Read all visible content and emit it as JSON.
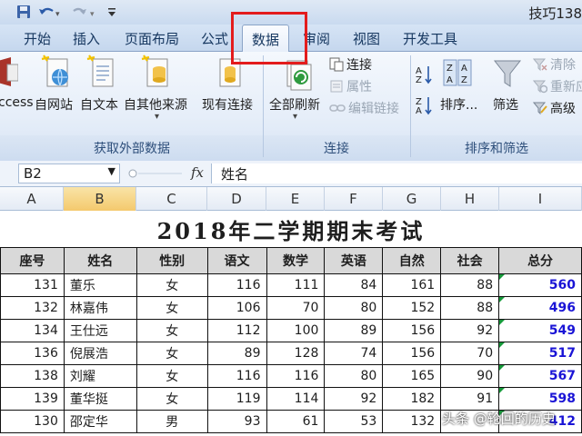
{
  "window": {
    "title": "技巧138"
  },
  "tabs": [
    "开始",
    "插入",
    "页面布局",
    "公式",
    "数据",
    "审阅",
    "视图",
    "开发工具"
  ],
  "ribbon": {
    "external_data": {
      "label": "获取外部数据",
      "buttons": [
        "ccess",
        "自网站",
        "自文本",
        "自其他来源",
        "现有连接"
      ]
    },
    "connections": {
      "label": "连接",
      "refresh_all": "全部刷新",
      "connections": "连接",
      "properties": "属性",
      "edit_links": "编辑链接"
    },
    "sort_filter": {
      "label": "排序和筛选",
      "sort": "排序...",
      "filter": "筛选",
      "clear": "清除",
      "reapply": "重新应",
      "advanced": "高级"
    }
  },
  "formula_bar": {
    "name_box": "B2",
    "fx": "fx",
    "content": "姓名"
  },
  "column_headers": [
    "A",
    "B",
    "C",
    "D",
    "E",
    "F",
    "G",
    "H",
    "I"
  ],
  "sheet": {
    "title": "2018年二学期期末考试",
    "headers": [
      "座号",
      "姓名",
      "性别",
      "语文",
      "数学",
      "英语",
      "自然",
      "社会",
      "总分"
    ],
    "rows": [
      [
        "131",
        "董乐",
        "女",
        "116",
        "111",
        "84",
        "161",
        "88",
        "560"
      ],
      [
        "132",
        "林嘉伟",
        "女",
        "106",
        "70",
        "80",
        "152",
        "88",
        "496"
      ],
      [
        "134",
        "王仕远",
        "女",
        "112",
        "100",
        "89",
        "156",
        "92",
        "549"
      ],
      [
        "136",
        "倪展浩",
        "女",
        "89",
        "128",
        "74",
        "156",
        "70",
        "517"
      ],
      [
        "138",
        "刘耀",
        "女",
        "116",
        "116",
        "80",
        "165",
        "90",
        "567"
      ],
      [
        "139",
        "董华挺",
        "女",
        "119",
        "114",
        "92",
        "182",
        "91",
        "598"
      ],
      [
        "130",
        "邵定华",
        "男",
        "93",
        "61",
        "53",
        "132",
        "",
        "412"
      ]
    ]
  },
  "watermark": "头条 @轮回的历史",
  "colors": {
    "total_text": "#1a14d6",
    "highlight_box": "#e31c1c"
  }
}
